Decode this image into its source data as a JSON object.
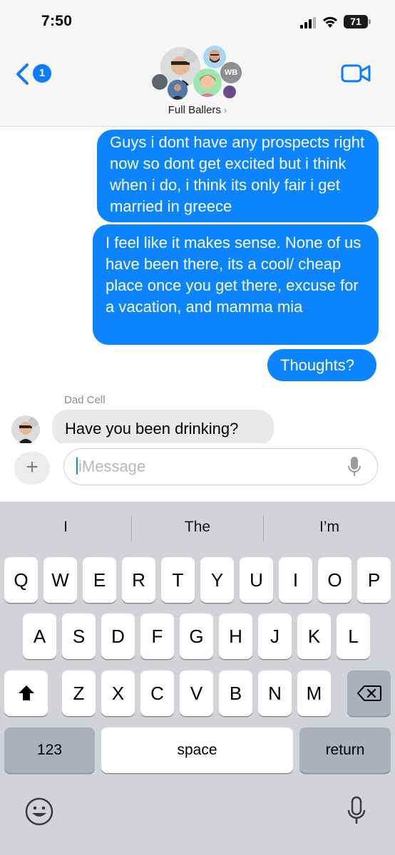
{
  "status_bar": {
    "time": "7:50",
    "battery": "71"
  },
  "header": {
    "back_badge": "1",
    "group_name": "Full Ballers",
    "avatar_initials": "WB"
  },
  "messages": [
    {
      "direction": "outgoing",
      "text": "Guys i dont have any prospects right now so dont get excited but i think when i do, i think its only fair i get married in greece"
    },
    {
      "direction": "outgoing",
      "text": "I feel like it makes sense. None of us have been there, its a cool/ cheap place once you get there, excuse for a vacation, and mamma mia"
    },
    {
      "direction": "outgoing",
      "text": "Thoughts?"
    },
    {
      "direction": "incoming",
      "sender": "Dad Cell",
      "text": "Have you been drinking?"
    }
  ],
  "composer": {
    "placeholder": "iMessage"
  },
  "keyboard": {
    "predictions": [
      "I",
      "The",
      "I’m"
    ],
    "row1": [
      "Q",
      "W",
      "E",
      "R",
      "T",
      "Y",
      "U",
      "I",
      "O",
      "P"
    ],
    "row2": [
      "A",
      "S",
      "D",
      "F",
      "G",
      "H",
      "J",
      "K",
      "L"
    ],
    "row3": [
      "Z",
      "X",
      "C",
      "V",
      "B",
      "N",
      "M"
    ],
    "numbers_label": "123",
    "space_label": "space",
    "return_label": "return"
  },
  "colors": {
    "accent": "#0b84fe",
    "incoming_bubble": "#e9e9eb",
    "keyboard_bg": "#d1d3d9"
  }
}
